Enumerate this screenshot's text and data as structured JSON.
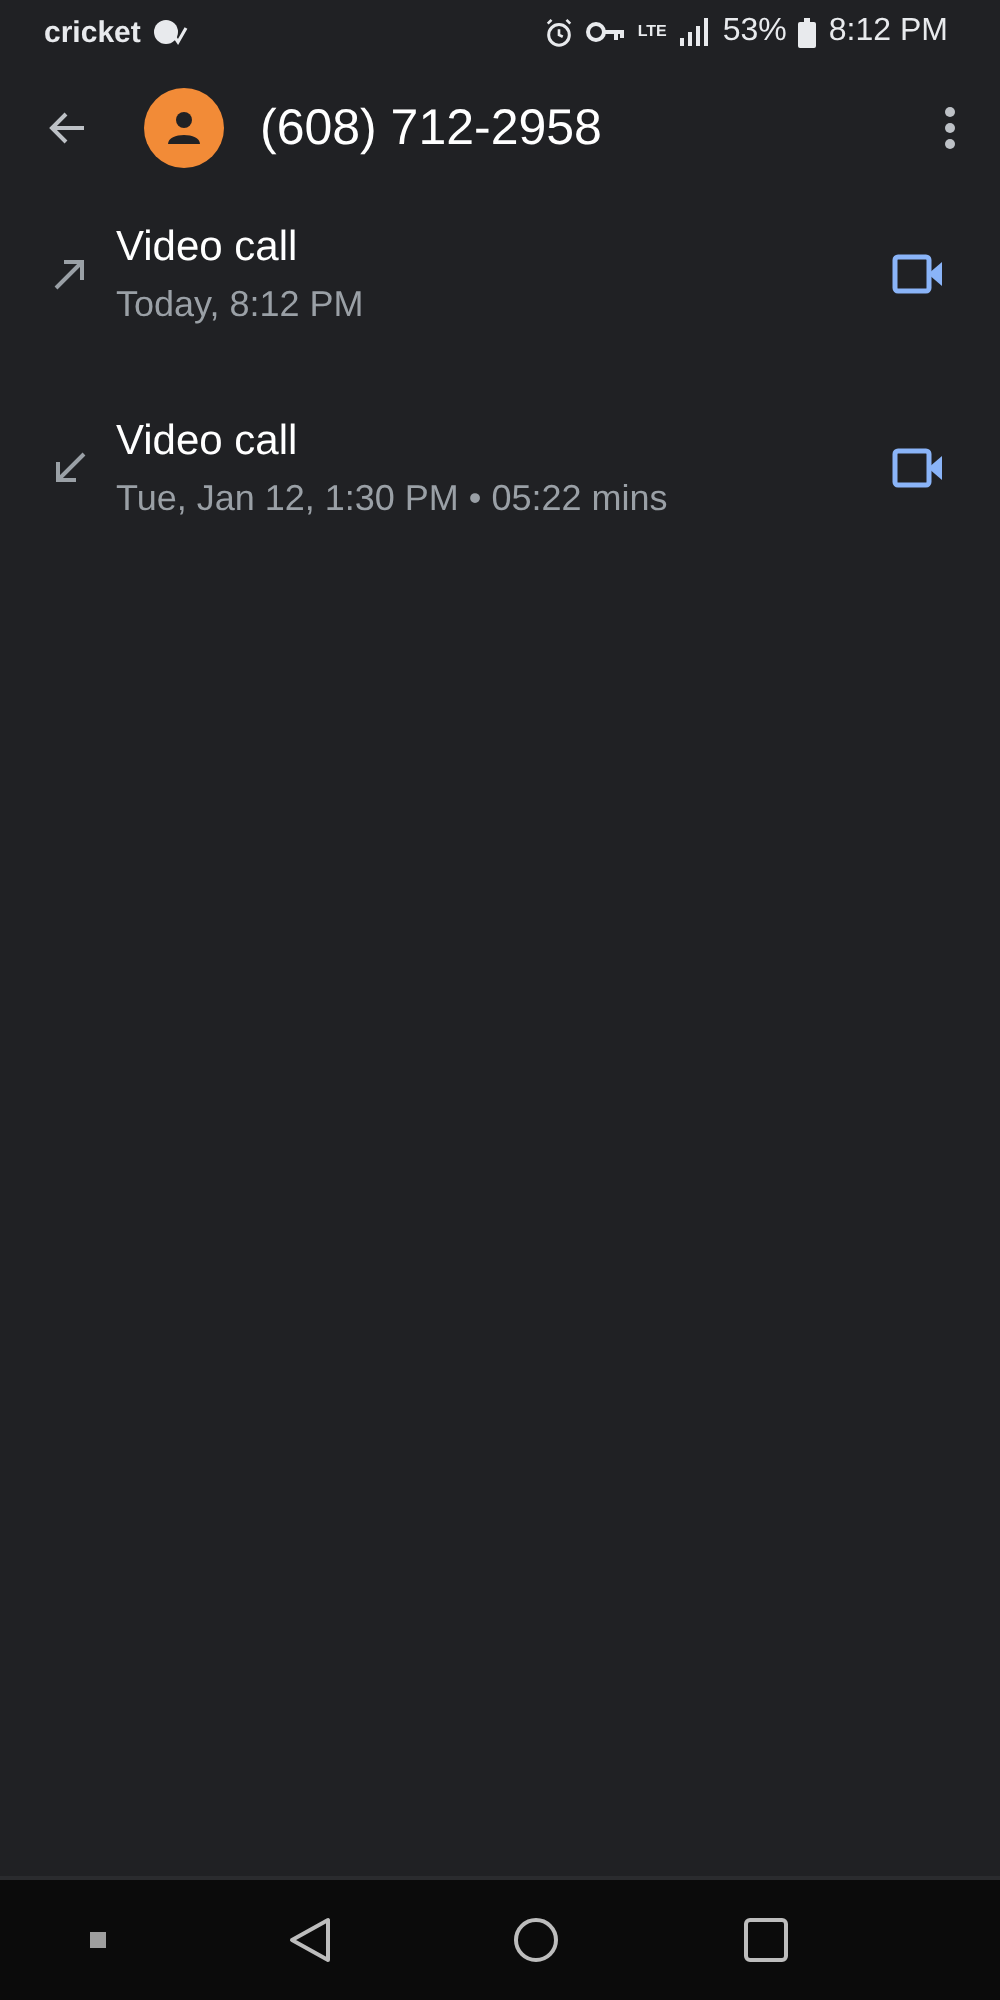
{
  "status_bar": {
    "carrier": "cricket",
    "network": "LTE",
    "battery": "53%",
    "time": "8:12 PM"
  },
  "header": {
    "title": "(608) 712-2958"
  },
  "calls": [
    {
      "kind": "outgoing",
      "title": "Video call",
      "detail": "Today, 8:12 PM"
    },
    {
      "kind": "incoming",
      "title": "Video call",
      "detail": "Tue, Jan 12, 1:30 PM • 05:22 mins"
    }
  ]
}
